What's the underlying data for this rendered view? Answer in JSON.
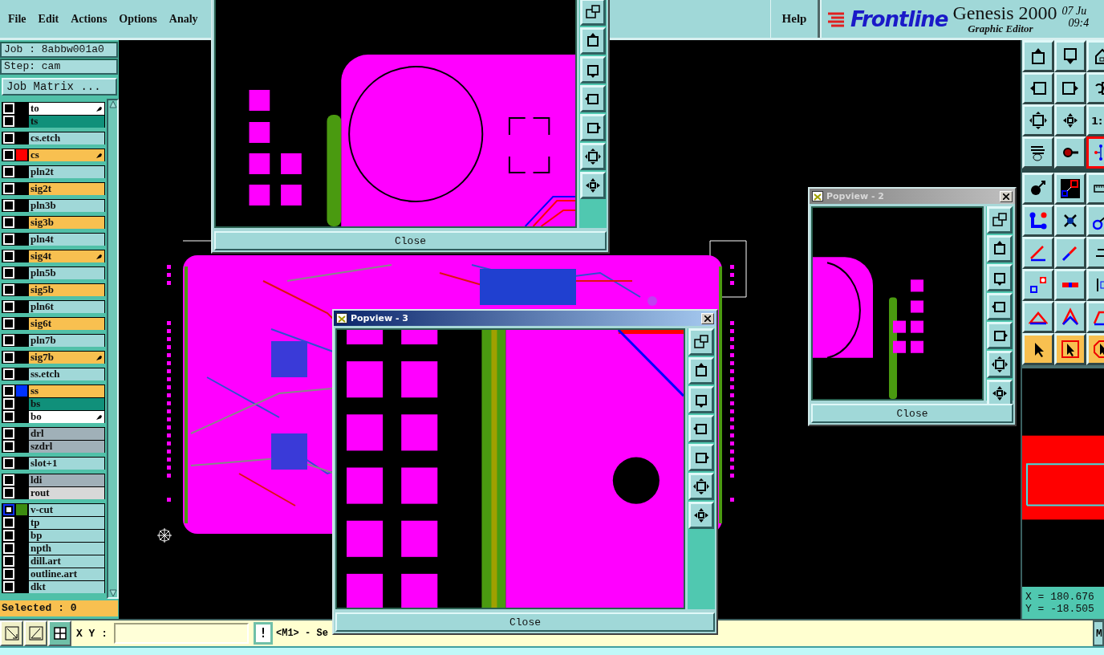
{
  "menu": [
    "File",
    "Edit",
    "Actions",
    "Options",
    "Analy"
  ],
  "help": "Help",
  "brand": {
    "logo": "Frontline",
    "title": "Genesis 2000",
    "subtitle": "Graphic Editor",
    "date": "07 Ju",
    "time": "09:4"
  },
  "job": "Job : 8abbw001a0",
  "step": "Step: cam",
  "job_matrix": "Job Matrix ...",
  "layer_groups": [
    {
      "layers": [
        {
          "name": "to",
          "kind": "silk",
          "edit": true,
          "focus": false
        },
        {
          "name": "ts",
          "kind": "mask",
          "edit": false,
          "focus": false
        }
      ]
    },
    {
      "layers": [
        {
          "name": "cs.etch",
          "kind": "document",
          "edit": false,
          "focus": false
        }
      ]
    },
    {
      "layers": [
        {
          "name": "cs",
          "kind": "signal",
          "color": "#ff0000",
          "edit": true,
          "focus": false
        }
      ]
    },
    {
      "layers": [
        {
          "name": "pln2t",
          "kind": "power",
          "edit": false,
          "focus": false
        }
      ]
    },
    {
      "layers": [
        {
          "name": "sig2t",
          "kind": "signal",
          "edit": false,
          "focus": false
        }
      ]
    },
    {
      "layers": [
        {
          "name": "pln3b",
          "kind": "power",
          "edit": false,
          "focus": false
        }
      ]
    },
    {
      "layers": [
        {
          "name": "sig3b",
          "kind": "signal",
          "edit": false,
          "focus": false
        }
      ]
    },
    {
      "layers": [
        {
          "name": "pln4t",
          "kind": "power",
          "edit": false,
          "focus": false
        }
      ]
    },
    {
      "layers": [
        {
          "name": "sig4t",
          "kind": "signal",
          "edit": true,
          "focus": false
        }
      ]
    },
    {
      "layers": [
        {
          "name": "pln5b",
          "kind": "power",
          "edit": false,
          "focus": false
        }
      ]
    },
    {
      "layers": [
        {
          "name": "sig5b",
          "kind": "signal",
          "edit": false,
          "focus": false
        }
      ]
    },
    {
      "layers": [
        {
          "name": "pln6t",
          "kind": "power",
          "edit": false,
          "focus": false
        }
      ]
    },
    {
      "layers": [
        {
          "name": "sig6t",
          "kind": "signal",
          "edit": false,
          "focus": false
        }
      ]
    },
    {
      "layers": [
        {
          "name": "pln7b",
          "kind": "power",
          "edit": false,
          "focus": false
        }
      ]
    },
    {
      "layers": [
        {
          "name": "sig7b",
          "kind": "signal",
          "edit": true,
          "focus": false
        }
      ]
    },
    {
      "layers": [
        {
          "name": "ss.etch",
          "kind": "document",
          "edit": false,
          "focus": false
        }
      ]
    },
    {
      "layers": [
        {
          "name": "ss",
          "kind": "signal",
          "color": "#0033ff",
          "edit": false,
          "focus": false
        },
        {
          "name": "bs",
          "kind": "mask",
          "edit": false,
          "focus": false
        },
        {
          "name": "bo",
          "kind": "silk",
          "edit": true,
          "focus": false
        }
      ]
    },
    {
      "layers": [
        {
          "name": "drl",
          "kind": "drill",
          "edit": false,
          "focus": false
        },
        {
          "name": "szdrl",
          "kind": "drill",
          "edit": false,
          "focus": false
        }
      ]
    },
    {
      "layers": [
        {
          "name": "slot+1",
          "kind": "document",
          "edit": false,
          "focus": false
        }
      ]
    },
    {
      "layers": [
        {
          "name": "ldi",
          "kind": "drill",
          "edit": false,
          "focus": false
        },
        {
          "name": "rout",
          "kind": "rout",
          "edit": false,
          "focus": false
        }
      ]
    },
    {
      "layers": [
        {
          "name": "v-cut",
          "kind": "document",
          "color": "#3c8c10",
          "edit": false,
          "focus": true
        },
        {
          "name": "tp",
          "kind": "document",
          "edit": false,
          "focus": false
        },
        {
          "name": "bp",
          "kind": "document",
          "edit": false,
          "focus": false
        },
        {
          "name": "npth",
          "kind": "document",
          "edit": false,
          "focus": false
        },
        {
          "name": "dill.art",
          "kind": "document",
          "edit": false,
          "focus": false
        },
        {
          "name": "outline.art",
          "kind": "document",
          "edit": false,
          "focus": false
        },
        {
          "name": "dkt",
          "kind": "document",
          "edit": false,
          "focus": false
        }
      ]
    }
  ],
  "selected_count": "Selected : 0",
  "tools": [
    {
      "kind": "tool",
      "selected": false
    },
    {
      "kind": "tool",
      "selected": false
    },
    {
      "kind": "tool",
      "selected": false
    },
    {
      "kind": "tool",
      "selected": false
    },
    {
      "kind": "tool",
      "selected": false
    },
    {
      "kind": "tool",
      "selected": false
    },
    {
      "kind": "tool",
      "selected": false
    },
    {
      "kind": "tool",
      "selected": false
    },
    {
      "kind": "tool",
      "selected": false,
      "label": "1:"
    },
    {
      "kind": "tool",
      "selected": false
    },
    {
      "kind": "tool",
      "selected": false
    },
    {
      "kind": "tool",
      "selected": true
    },
    {
      "kind": "tool",
      "selected": false
    },
    {
      "kind": "tool",
      "selected": false
    },
    {
      "kind": "tool",
      "selected": false
    },
    {
      "kind": "tool",
      "selected": false
    },
    {
      "kind": "tool",
      "selected": false
    },
    {
      "kind": "tool",
      "selected": false
    },
    {
      "kind": "tool",
      "selected": false
    },
    {
      "kind": "tool",
      "selected": false
    },
    {
      "kind": "tool",
      "selected": false
    },
    {
      "kind": "tool",
      "selected": false
    },
    {
      "kind": "tool",
      "selected": false
    },
    {
      "kind": "tool",
      "selected": false
    },
    {
      "kind": "tool",
      "selected": false
    },
    {
      "kind": "tool",
      "selected": false
    },
    {
      "kind": "tool",
      "selected": false
    },
    {
      "kind": "mode",
      "selected": false
    },
    {
      "kind": "mode",
      "selected": false
    },
    {
      "kind": "mode",
      "selected": false
    }
  ],
  "coordinates": {
    "x": "X = 180.676",
    "y": "Y = -18.505"
  },
  "bottom_bar": {
    "xy_label": "X Y :",
    "alert": "!",
    "message": "<M1> - Se",
    "menu_button": "M"
  },
  "popviews": [
    {
      "close": "Close"
    },
    {
      "title": "Popview - 2",
      "active": false,
      "close": "Close"
    },
    {
      "title": "Popview - 3",
      "active": true,
      "close": "Close"
    }
  ]
}
